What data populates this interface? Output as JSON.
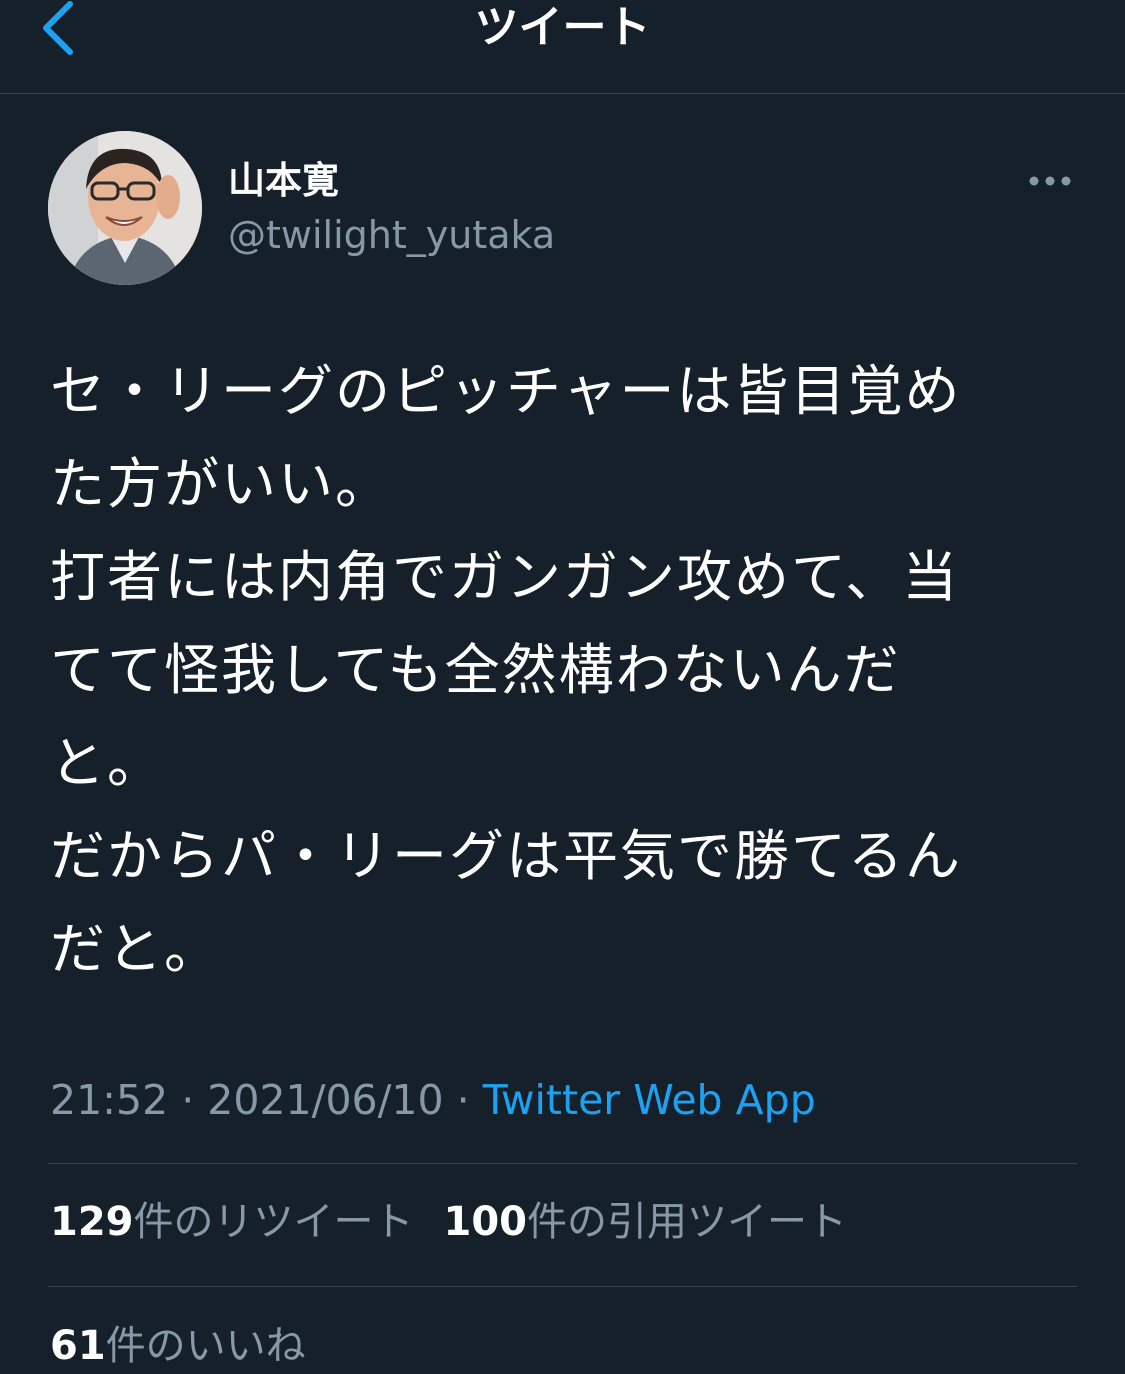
{
  "header": {
    "title": "ツイート",
    "back_icon": "chevron-left-icon",
    "accent_color": "#1da1f2"
  },
  "author": {
    "name": "山本寛",
    "handle": "@twilight_yutaka",
    "more_icon": "more-horizontal-icon"
  },
  "tweet": {
    "text": "セ・リーグのピッチャーは皆目覚め\nた方がいい。\n打者には内角でガンガン攻めて、当\nてて怪我しても全然構わないんだ\nと。\nだからパ・リーグは平気で勝てるん\nだと。"
  },
  "meta": {
    "time": "21:52",
    "separator": "·",
    "date": "2021/06/10",
    "source": "Twitter Web App"
  },
  "stats": {
    "retweets": {
      "count": "129",
      "label": "件のリツイート"
    },
    "quotes": {
      "count": "100",
      "label": "件の引用ツイート"
    },
    "likes": {
      "count": "61",
      "label": "件のいいね"
    }
  },
  "colors": {
    "background": "#15202b",
    "text": "#ffffff",
    "secondary": "#8899a6",
    "border": "#38444d"
  }
}
